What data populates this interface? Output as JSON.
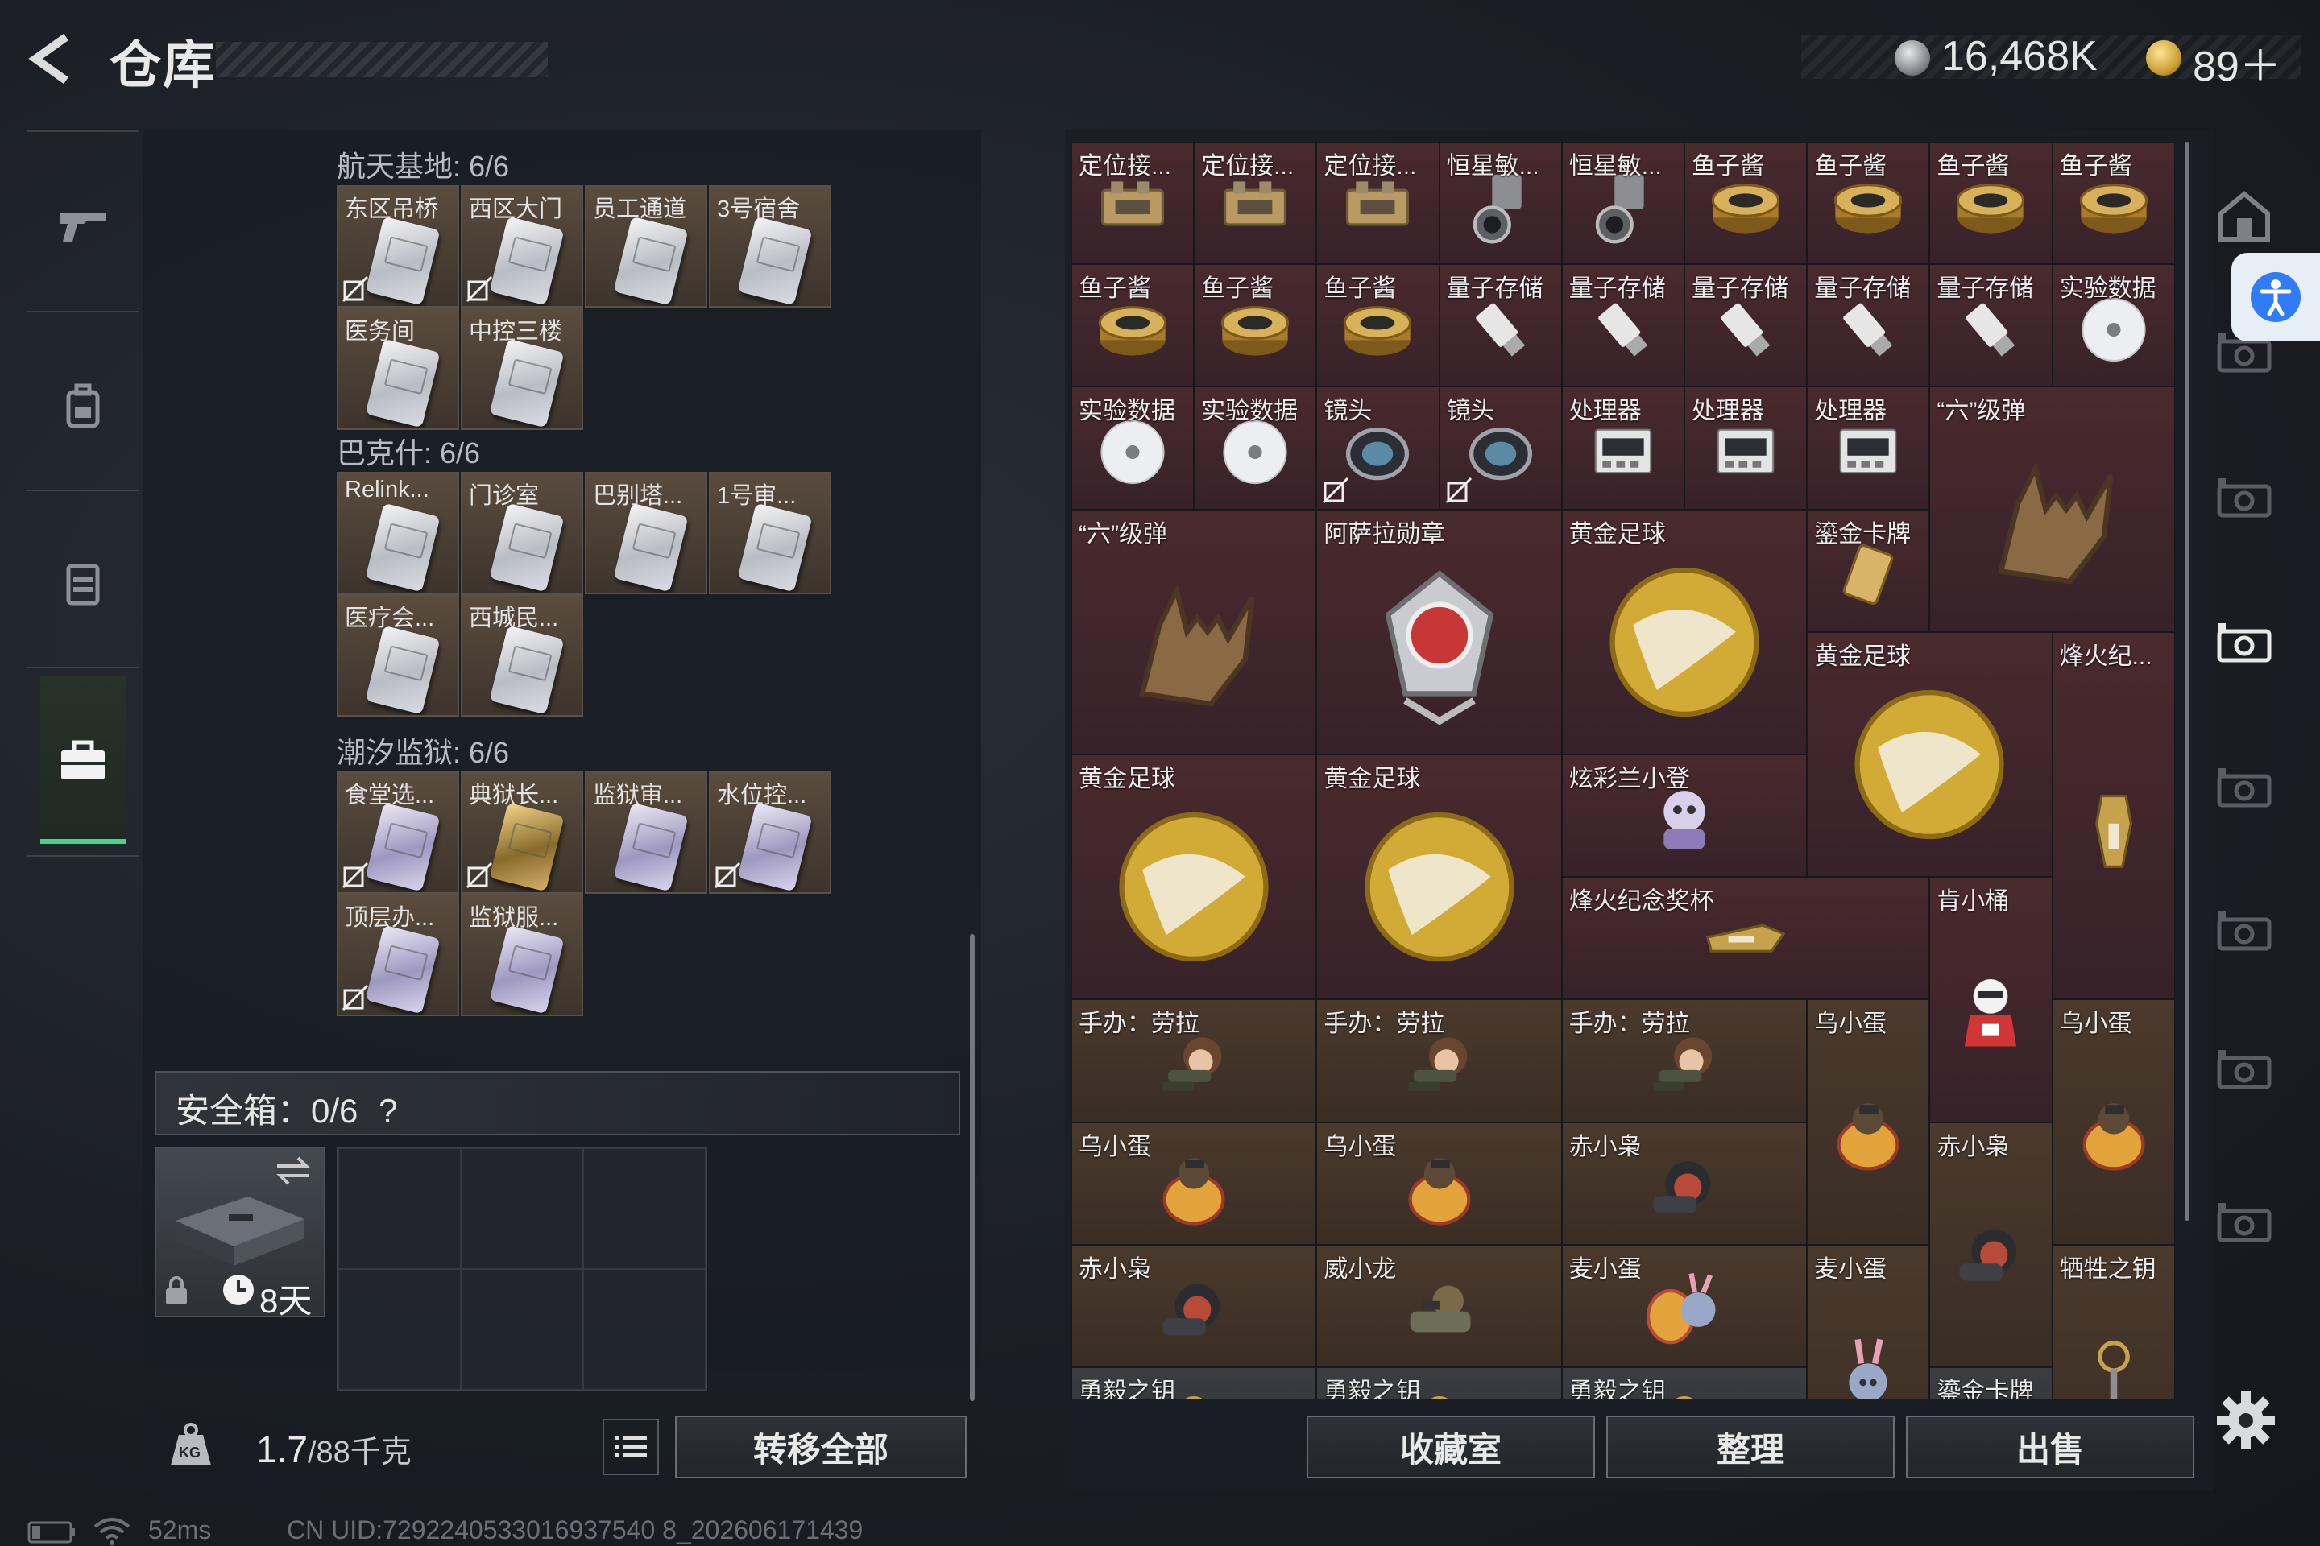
{
  "header": {
    "title": "仓库",
    "silver_value": "16,468K",
    "gold_value": "89＋"
  },
  "left_nav": {
    "items": [
      "gun-icon",
      "backpack-icon",
      "vest-icon",
      "briefcase-icon"
    ],
    "active": "briefcase-icon"
  },
  "key_groups": [
    {
      "title": "航天基地: 6/6",
      "slots": [
        {
          "label": "东区吊桥",
          "card": "silver",
          "no_insure": true
        },
        {
          "label": "西区大门",
          "card": "silver",
          "no_insure": true
        },
        {
          "label": "员工通道",
          "card": "silver",
          "no_insure": false
        },
        {
          "label": "3号宿舍",
          "card": "silver",
          "no_insure": false
        },
        {
          "label": "医务间",
          "card": "silver",
          "no_insure": false
        },
        {
          "label": "中控三楼",
          "card": "silver",
          "no_insure": false
        }
      ]
    },
    {
      "title": "巴克什: 6/6",
      "slots": [
        {
          "label": "Relink...",
          "card": "silver",
          "no_insure": false
        },
        {
          "label": "门诊室",
          "card": "silver",
          "no_insure": false
        },
        {
          "label": "巴别塔...",
          "card": "silver",
          "no_insure": false
        },
        {
          "label": "1号审...",
          "card": "silver",
          "no_insure": false
        },
        {
          "label": "医疗会...",
          "card": "silver",
          "no_insure": false
        },
        {
          "label": "西城民...",
          "card": "silver",
          "no_insure": false
        }
      ]
    },
    {
      "title": "潮汐监狱: 6/6",
      "slots": [
        {
          "label": "食堂选...",
          "card": "purple",
          "no_insure": true
        },
        {
          "label": "典狱长...",
          "card": "gold",
          "no_insure": true
        },
        {
          "label": "监狱审...",
          "card": "purple",
          "no_insure": false
        },
        {
          "label": "水位控...",
          "card": "purple",
          "no_insure": true
        },
        {
          "label": "顶层办...",
          "card": "purple",
          "no_insure": true
        },
        {
          "label": "监狱服...",
          "card": "purple",
          "no_insure": false
        }
      ]
    }
  ],
  "safe_box": {
    "label": "安全箱：0/6",
    "help": "?",
    "days": "8天"
  },
  "bottom_left": {
    "weight_value": "1.7",
    "weight_suffix": "/88千克",
    "transfer_label": "转移全部",
    "weight_icon_text": "KG"
  },
  "inventory": [
    {
      "label": "定位接...",
      "art": "device",
      "bg": "red",
      "c": 0,
      "r": 0,
      "w": 1,
      "h": 1
    },
    {
      "label": "定位接...",
      "art": "device",
      "bg": "red",
      "c": 1,
      "r": 0,
      "w": 1,
      "h": 1
    },
    {
      "label": "定位接...",
      "art": "device",
      "bg": "red",
      "c": 2,
      "r": 0,
      "w": 1,
      "h": 1
    },
    {
      "label": "恒星敏...",
      "art": "sensor",
      "bg": "red",
      "c": 3,
      "r": 0,
      "w": 1,
      "h": 1
    },
    {
      "label": "恒星敏...",
      "art": "sensor",
      "bg": "red",
      "c": 4,
      "r": 0,
      "w": 1,
      "h": 1
    },
    {
      "label": "鱼子酱",
      "art": "caviar",
      "bg": "red",
      "c": 5,
      "r": 0,
      "w": 1,
      "h": 1
    },
    {
      "label": "鱼子酱",
      "art": "caviar",
      "bg": "red",
      "c": 6,
      "r": 0,
      "w": 1,
      "h": 1
    },
    {
      "label": "鱼子酱",
      "art": "caviar",
      "bg": "red",
      "c": 7,
      "r": 0,
      "w": 1,
      "h": 1
    },
    {
      "label": "鱼子酱",
      "art": "caviar",
      "bg": "red",
      "c": 8,
      "r": 0,
      "w": 1,
      "h": 1
    },
    {
      "label": "鱼子酱",
      "art": "caviar",
      "bg": "red",
      "c": 0,
      "r": 1,
      "w": 1,
      "h": 1
    },
    {
      "label": "鱼子酱",
      "art": "caviar",
      "bg": "red",
      "c": 1,
      "r": 1,
      "w": 1,
      "h": 1
    },
    {
      "label": "鱼子酱",
      "art": "caviar",
      "bg": "red",
      "c": 2,
      "r": 1,
      "w": 1,
      "h": 1
    },
    {
      "label": "量子存储",
      "art": "usb",
      "bg": "red",
      "c": 3,
      "r": 1,
      "w": 1,
      "h": 1
    },
    {
      "label": "量子存储",
      "art": "usb",
      "bg": "red",
      "c": 4,
      "r": 1,
      "w": 1,
      "h": 1
    },
    {
      "label": "量子存储",
      "art": "usb",
      "bg": "red",
      "c": 5,
      "r": 1,
      "w": 1,
      "h": 1
    },
    {
      "label": "量子存储",
      "art": "usb",
      "bg": "red",
      "c": 6,
      "r": 1,
      "w": 1,
      "h": 1
    },
    {
      "label": "量子存储",
      "art": "usb",
      "bg": "red",
      "c": 7,
      "r": 1,
      "w": 1,
      "h": 1
    },
    {
      "label": "实验数据",
      "art": "disc",
      "bg": "red",
      "c": 8,
      "r": 1,
      "w": 1,
      "h": 1
    },
    {
      "label": "实验数据",
      "art": "disc",
      "bg": "red",
      "c": 0,
      "r": 2,
      "w": 1,
      "h": 1
    },
    {
      "label": "实验数据",
      "art": "disc",
      "bg": "red",
      "c": 1,
      "r": 2,
      "w": 1,
      "h": 1
    },
    {
      "label": "镜头",
      "art": "lens",
      "bg": "red",
      "c": 2,
      "r": 2,
      "w": 1,
      "h": 1,
      "no_insure": true
    },
    {
      "label": "镜头",
      "art": "lens",
      "bg": "red",
      "c": 3,
      "r": 2,
      "w": 1,
      "h": 1,
      "no_insure": true
    },
    {
      "label": "处理器",
      "art": "cpu",
      "bg": "red",
      "c": 4,
      "r": 2,
      "w": 1,
      "h": 1
    },
    {
      "label": "处理器",
      "art": "cpu",
      "bg": "red",
      "c": 5,
      "r": 2,
      "w": 1,
      "h": 1
    },
    {
      "label": "处理器",
      "art": "cpu",
      "bg": "red",
      "c": 6,
      "r": 2,
      "w": 1,
      "h": 1
    },
    {
      "label": "“六”级弹",
      "art": "hand",
      "bg": "red",
      "c": 7,
      "r": 2,
      "w": 2,
      "h": 2
    },
    {
      "label": "“六”级弹",
      "art": "hand",
      "bg": "red",
      "c": 0,
      "r": 3,
      "w": 2,
      "h": 2
    },
    {
      "label": "阿萨拉勋章",
      "art": "medal",
      "bg": "red",
      "c": 2,
      "r": 3,
      "w": 2,
      "h": 2
    },
    {
      "label": "黄金足球",
      "art": "ball",
      "bg": "red",
      "c": 4,
      "r": 3,
      "w": 2,
      "h": 2
    },
    {
      "label": "鎏金卡牌",
      "art": "goldcard",
      "bg": "red",
      "c": 6,
      "r": 3,
      "w": 1,
      "h": 1
    },
    {
      "label": "黄金足球",
      "art": "ball",
      "bg": "red",
      "c": 6,
      "r": 4,
      "w": 2,
      "h": 2
    },
    {
      "label": "烽火纪...",
      "art": "trophy",
      "bg": "red",
      "c": 8,
      "r": 4,
      "w": 1,
      "h": 3
    },
    {
      "label": "黄金足球",
      "art": "ball",
      "bg": "red",
      "c": 0,
      "r": 5,
      "w": 2,
      "h": 2
    },
    {
      "label": "黄金足球",
      "art": "ball",
      "bg": "red",
      "c": 2,
      "r": 5,
      "w": 2,
      "h": 2
    },
    {
      "label": "炫彩兰小登",
      "art": "figure-purple",
      "bg": "red",
      "c": 4,
      "r": 5,
      "w": 2,
      "h": 1
    },
    {
      "label": "烽火纪念奖杯",
      "art": "trophy-flat",
      "bg": "red",
      "c": 4,
      "r": 6,
      "w": 3,
      "h": 1
    },
    {
      "label": "肯小桶",
      "art": "colonel",
      "bg": "red",
      "c": 7,
      "r": 6,
      "w": 1,
      "h": 2
    },
    {
      "label": "手办：劳拉",
      "art": "figure-lara",
      "bg": "brown",
      "c": 0,
      "r": 7,
      "w": 2,
      "h": 1
    },
    {
      "label": "手办：劳拉",
      "art": "figure-lara",
      "bg": "brown",
      "c": 2,
      "r": 7,
      "w": 2,
      "h": 1
    },
    {
      "label": "手办：劳拉",
      "art": "figure-lara",
      "bg": "brown",
      "c": 4,
      "r": 7,
      "w": 2,
      "h": 1
    },
    {
      "label": "乌小蛋",
      "art": "egg-fig",
      "bg": "brown",
      "c": 6,
      "r": 7,
      "w": 1,
      "h": 2
    },
    {
      "label": "乌小蛋",
      "art": "egg-fig",
      "bg": "brown",
      "c": 8,
      "r": 7,
      "w": 1,
      "h": 2
    },
    {
      "label": "乌小蛋",
      "art": "egg-fig",
      "bg": "brown",
      "c": 0,
      "r": 8,
      "w": 2,
      "h": 1
    },
    {
      "label": "乌小蛋",
      "art": "egg-fig",
      "bg": "brown",
      "c": 2,
      "r": 8,
      "w": 2,
      "h": 1
    },
    {
      "label": "赤小枭",
      "art": "hood-fig",
      "bg": "brown",
      "c": 4,
      "r": 8,
      "w": 2,
      "h": 1
    },
    {
      "label": "赤小枭",
      "art": "hood-fig",
      "bg": "brown",
      "c": 7,
      "r": 8,
      "w": 1,
      "h": 2
    },
    {
      "label": "赤小枭",
      "art": "hood-fig",
      "bg": "brown",
      "c": 0,
      "r": 9,
      "w": 2,
      "h": 1
    },
    {
      "label": "威小龙",
      "art": "soldier-fig",
      "bg": "brown",
      "c": 2,
      "r": 9,
      "w": 2,
      "h": 1
    },
    {
      "label": "麦小蛋",
      "art": "bunny-egg",
      "bg": "brown",
      "c": 4,
      "r": 9,
      "w": 2,
      "h": 1
    },
    {
      "label": "麦小蛋",
      "art": "bunny-fig",
      "bg": "brown",
      "c": 6,
      "r": 9,
      "w": 1,
      "h": 2
    },
    {
      "label": "牺牲之钥",
      "art": "key",
      "bg": "brown",
      "c": 8,
      "r": 9,
      "w": 1,
      "h": 2
    },
    {
      "label": "勇毅之钥",
      "art": "key",
      "bg": "gray",
      "c": 0,
      "r": 10,
      "w": 2,
      "h": 1
    },
    {
      "label": "勇毅之钥",
      "art": "key",
      "bg": "gray",
      "c": 2,
      "r": 10,
      "w": 2,
      "h": 1
    },
    {
      "label": "勇毅之钥",
      "art": "key",
      "bg": "gray",
      "c": 4,
      "r": 10,
      "w": 2,
      "h": 1
    },
    {
      "label": "鎏金卡牌",
      "art": "goldcard",
      "bg": "gray",
      "c": 7,
      "r": 10,
      "w": 1,
      "h": 1
    }
  ],
  "bottom_right": {
    "fav_label": "收藏室",
    "sort_label": "整理",
    "sell_label": "出售"
  },
  "side_icons": [
    "home-icon",
    "storage-v-icon",
    "storage-v-icon",
    "storage-v-active-icon",
    "storage-v-icon",
    "storage-iv-icon",
    "storage-iv-icon",
    "storage-iv-icon"
  ],
  "status": {
    "ping": "52ms",
    "uid": "CN UID:7292240533016937540 8_202606171439"
  }
}
